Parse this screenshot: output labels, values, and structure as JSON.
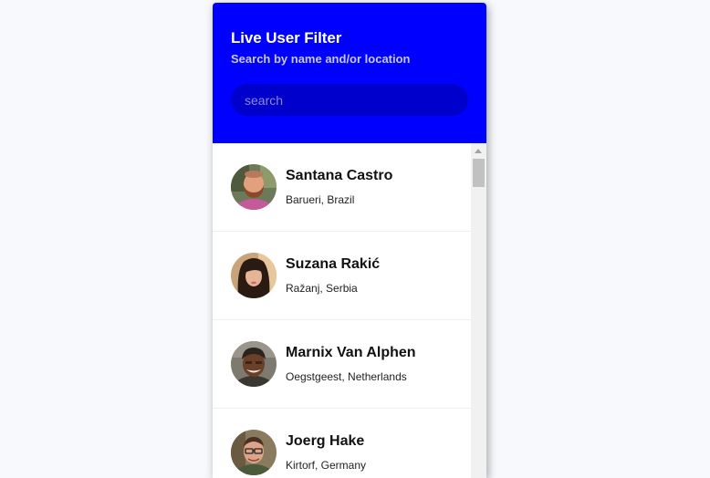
{
  "header": {
    "title": "Live User Filter",
    "subtitle": "Search by name and/or location",
    "search_placeholder": "search",
    "background_color": "#0000ff"
  },
  "users": [
    {
      "name": "Santana Castro",
      "location": "Barueri, Brazil",
      "avatar": "man-with-beard-avatar"
    },
    {
      "name": "Suzana Rakić",
      "location": "Ražanj, Serbia",
      "avatar": "woman-long-dark-hair-avatar"
    },
    {
      "name": "Marnix Van Alphen",
      "location": "Oegstgeest, Netherlands",
      "avatar": "man-with-cap-avatar"
    },
    {
      "name": "Joerg Hake",
      "location": "Kirtorf, Germany",
      "avatar": "man-with-glasses-avatar"
    }
  ]
}
